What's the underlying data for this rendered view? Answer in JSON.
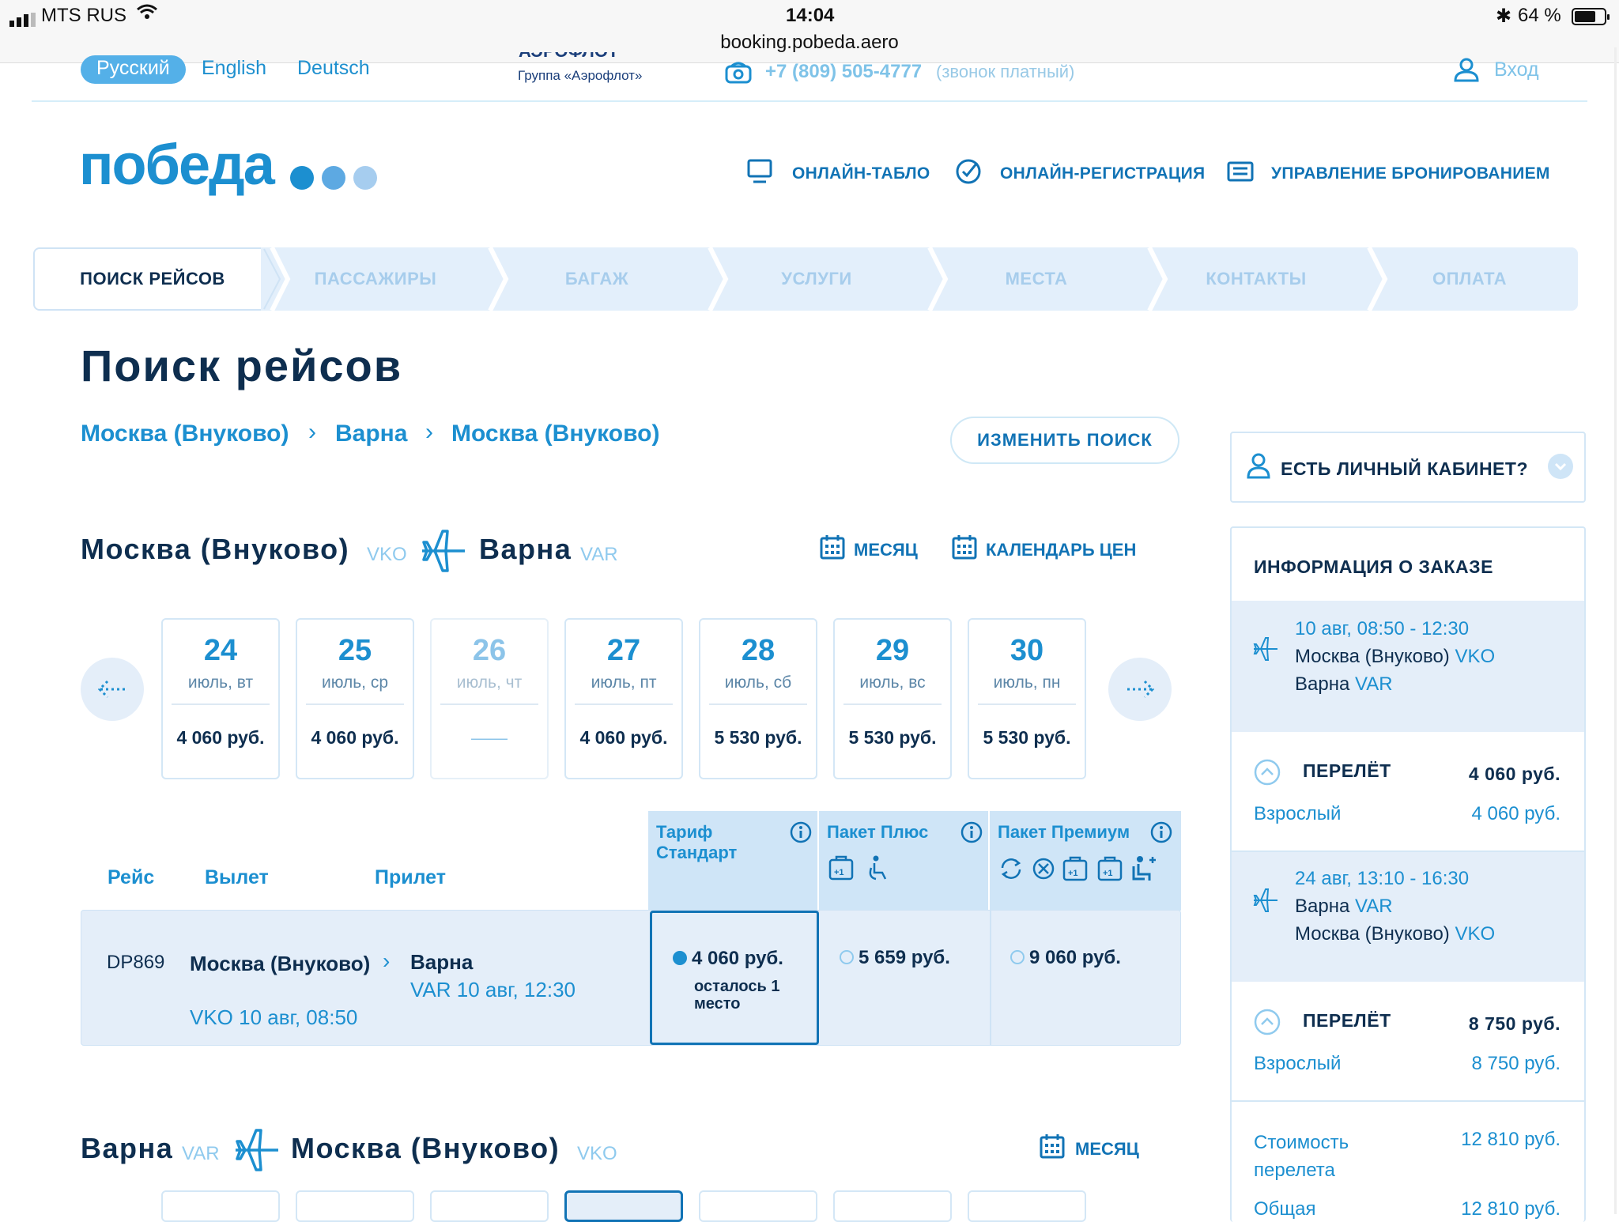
{
  "statusbar": {
    "carrier": "MTS RUS",
    "time": "14:04",
    "url": "booking.pobeda.aero",
    "battery": "64 %"
  },
  "top": {
    "lang_ru": "Русский",
    "lang_en": "English",
    "lang_de": "Deutsch",
    "aeroflot_text": "Группа «Аэрофлот»",
    "phone": "+7 (809) 505-4777",
    "phone_note": "(звонок платный)",
    "login": "Вход"
  },
  "brand": {
    "logo_text": "победа"
  },
  "nav": {
    "board": "ОНЛАЙН-ТАБЛО",
    "checkin": "ОНЛАЙН-РЕГИСТРАЦИЯ",
    "manage": "УПРАВЛЕНИЕ БРОНИРОВАНИЕМ"
  },
  "steps": [
    "ПОИСК РЕЙСОВ",
    "ПАССАЖИРЫ",
    "БАГАЖ",
    "УСЛУГИ",
    "МЕСТА",
    "КОНТАКТЫ",
    "ОПЛАТА"
  ],
  "page_title": "Поиск рейсов",
  "breadcrumb": [
    "Москва (Внуково)",
    "Варна",
    "Москва (Внуково)"
  ],
  "change_search": "ИЗМЕНИТЬ ПОИСК",
  "outbound": {
    "from": "Москва (Внуково)",
    "from_code": "VKO",
    "to": "Варна",
    "to_code": "VAR",
    "month": "МЕСЯЦ",
    "calendar": "КАЛЕНДАРЬ ЦЕН"
  },
  "dates": [
    {
      "day": "24",
      "wd": "июль, вт",
      "price": "4 060 руб."
    },
    {
      "day": "25",
      "wd": "июль, ср",
      "price": "4 060 руб."
    },
    {
      "day": "26",
      "wd": "июль, чт",
      "price": "——"
    },
    {
      "day": "27",
      "wd": "июль, пт",
      "price": "4 060 руб."
    },
    {
      "day": "28",
      "wd": "июль, сб",
      "price": "5 530 руб."
    },
    {
      "day": "29",
      "wd": "июль, вс",
      "price": "5 530 руб."
    },
    {
      "day": "30",
      "wd": "июль, пн",
      "price": "5 530 руб."
    }
  ],
  "table": {
    "col_flight": "Рейс",
    "col_dep": "Вылет",
    "col_arr": "Прилет",
    "tariff_std": "Тариф Стандарт",
    "tariff_plus": "Пакет Плюс",
    "tariff_premium": "Пакет Премиум"
  },
  "flight": {
    "number": "DP869",
    "dep_city": "Москва (Внуково)",
    "dep_time": "VKO 10 авг, 08:50",
    "arr_city": "Варна",
    "arr_time": "VAR 10 авг, 12:30",
    "price_std": "4 060 руб.",
    "seats_left": "осталось 1 место",
    "price_plus": "5 659 руб.",
    "price_premium": "9 060 руб."
  },
  "return": {
    "from": "Варна",
    "from_code": "VAR",
    "to": "Москва (Внуково)",
    "to_code": "VKO",
    "month": "МЕСЯЦ"
  },
  "side": {
    "cabinet": "ЕСТЬ ЛИЧНЫЙ КАБИНЕТ?",
    "order_title": "ИНФОРМАЦИЯ О ЗАКАЗЕ",
    "seg1": {
      "time": "10 авг, 08:50 - 12:30",
      "from": "Москва (Внуково)",
      "from_code": "VKO",
      "to": "Варна",
      "to_code": "VAR"
    },
    "leg1": {
      "label": "ПЕРЕЛЁТ",
      "total": "4 060 руб.",
      "pax": "Взрослый",
      "pax_price": "4 060 руб."
    },
    "seg2": {
      "time": "24 авг, 13:10 - 16:30",
      "from": "Варна",
      "from_code": "VAR",
      "to": "Москва (Внуково)",
      "to_code": "VKO"
    },
    "leg2": {
      "label": "ПЕРЕЛЁТ",
      "total": "8 750 руб.",
      "pax": "Взрослый",
      "pax_price": "8 750 руб."
    },
    "cost_label": "Стоимость перелета",
    "cost_value": "12 810 руб.",
    "total_label": "Общая",
    "total_value": "12 810 руб."
  },
  "colors": {
    "accent": "#1c8fd0",
    "dark": "#0e2e4f",
    "light_bg": "#e4eef9"
  }
}
